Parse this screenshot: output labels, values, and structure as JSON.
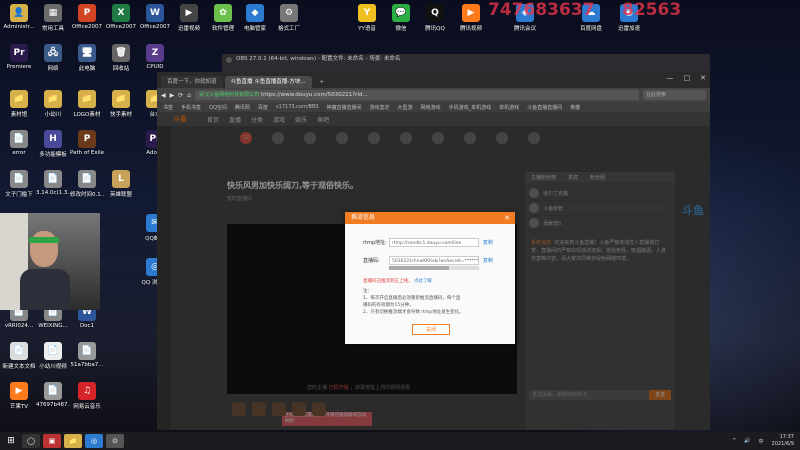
{
  "desktop": {
    "icons": [
      {
        "label": "Administr...",
        "glyph": "👤",
        "color": "#d6b04a"
      },
      {
        "label": "常用工具",
        "glyph": "▦",
        "color": "#6b6b6b"
      },
      {
        "label": "Office2007\n文档PPT",
        "glyph": "P",
        "color": "#d14424"
      },
      {
        "label": "Office2007\n表格",
        "glyph": "X",
        "color": "#1f7a44"
      },
      {
        "label": "Office2007\n文字",
        "glyph": "W",
        "color": "#2b579a"
      },
      {
        "label": "迅雷视频",
        "glyph": "▶",
        "color": "#444"
      },
      {
        "label": "软件管理",
        "glyph": "✿",
        "color": "#6ac04a"
      },
      {
        "label": "电脑管家",
        "glyph": "◆",
        "color": "#2d7bd1"
      },
      {
        "label": "格式工厂",
        "glyph": "⚙",
        "color": "#777"
      },
      {
        "label": "YY语音",
        "glyph": "Y",
        "color": "#f0c020"
      },
      {
        "label": "微信",
        "glyph": "💬",
        "color": "#2aae43"
      },
      {
        "label": "腾讯QQ",
        "glyph": "Q",
        "color": "#111"
      },
      {
        "label": "腾讯视频",
        "glyph": "▶",
        "color": "#ff7a1a"
      },
      {
        "label": "腾讯会议",
        "glyph": "◈",
        "color": "#2d7bd1"
      },
      {
        "label": "百度网盘",
        "glyph": "☁",
        "color": "#2d7bd1"
      },
      {
        "label": "迅雷加速",
        "glyph": "◉",
        "color": "#2d7bd1"
      },
      {
        "label": "Premiere\nCC2019",
        "glyph": "Pr",
        "color": "#2a1b4a"
      },
      {
        "label": "网络",
        "glyph": "🖧",
        "color": "#3a5a8a"
      },
      {
        "label": "此电脑",
        "glyph": "🖥",
        "color": "#3a5a8a"
      },
      {
        "label": "回收站",
        "glyph": "🗑",
        "color": "#666"
      },
      {
        "label": "CPUID\nCPU-Z",
        "glyph": "Z",
        "color": "#5a3a8a"
      },
      {
        "label": "素材馆",
        "glyph": "📁",
        "color": "#d6b04a"
      },
      {
        "label": "小幼川\n3u",
        "glyph": "📁",
        "color": "#d6b04a"
      },
      {
        "label": "LOGO素材",
        "glyph": "📁",
        "color": "#d6b04a"
      },
      {
        "label": "快手素材",
        "glyph": "📁",
        "color": "#d6b04a"
      },
      {
        "label": "台本",
        "glyph": "📁",
        "color": "#d6b04a"
      },
      {
        "label": "error",
        "glyph": "📄",
        "color": "#888"
      },
      {
        "label": "多功能模板\nAHK",
        "glyph": "H",
        "color": "#4a4a9a"
      },
      {
        "label": "Path of Exile",
        "glyph": "P",
        "color": "#6a3a1a"
      },
      {
        "label": "Adobe\nPremiere...",
        "glyph": "Pr",
        "color": "#2a1b4a"
      },
      {
        "label": "文子门槛下\n地址",
        "glyph": "📄",
        "color": "#888"
      },
      {
        "label": "3.14.0c(1.3...",
        "glyph": "📄",
        "color": "#888"
      },
      {
        "label": "修改时间0.1...",
        "glyph": "📄",
        "color": "#888"
      },
      {
        "label": "英雄联盟",
        "glyph": "L",
        "color": "#c8a25a"
      },
      {
        "label": "QQ邮箱",
        "glyph": "✉",
        "color": "#2d7bd1"
      },
      {
        "label": "QQ 浏览器",
        "glyph": "◎",
        "color": "#2d7bd1"
      },
      {
        "label": "vRRI024...",
        "glyph": "📄",
        "color": "#888"
      },
      {
        "label": "WEIXING...",
        "glyph": "📄",
        "color": "#888"
      },
      {
        "label": "Doc1",
        "glyph": "W",
        "color": "#2b579a"
      },
      {
        "label": "新建文本文档\n(2)",
        "glyph": "📄",
        "color": "#ddd"
      },
      {
        "label": "小幼川视频\n合辑面...",
        "glyph": "📄",
        "color": "#eee"
      },
      {
        "label": "51a7bba7...",
        "glyph": "📄",
        "color": "#999"
      },
      {
        "label": "芒果TV",
        "glyph": "▶",
        "color": "#ff7a1a"
      },
      {
        "label": "47697b487...",
        "glyph": "📄",
        "color": "#999"
      },
      {
        "label": "网易云音乐",
        "glyph": "♫",
        "color": "#d6252a"
      }
    ],
    "overlay_numbers": {
      "left": "747683637",
      "right": "82563"
    }
  },
  "obs": {
    "title": "OBS 27.0.1 (64-bit, windows) - 配置文件: 未命名 - 场景: 未命名"
  },
  "browser": {
    "tabs": [
      "百度一下，你就知道",
      "斗鱼直播 斗鱼直播直播-方块..."
    ],
    "new_tab": "+",
    "url": "https://www.douyu.com/5030221?rid...",
    "secure_label": "武汉斗鱼网络科技有限公司",
    "search_placeholder": "在此搜索",
    "bookmarks": [
      "书签",
      "手机书签",
      "QQ空间",
      "腾讯网",
      "百度",
      "c17173.com/BBS",
      "神魔直播直播间",
      "游戏鉴定",
      "大型游",
      "网络游戏",
      "手机游戏_单机游戏",
      "单机游戏",
      "斗鱼直播直播间",
      "英雄"
    ],
    "window_controls": [
      "—",
      "□",
      "✕"
    ]
  },
  "douyu": {
    "logo": "斗鱼",
    "nav": [
      "首页",
      "直播",
      "分类",
      "游戏",
      "娱乐",
      "鱼吧"
    ],
    "categories": [
      {
        "label": "12",
        "hot": true
      },
      {
        "label": "",
        "hot": false
      },
      {
        "label": "",
        "hot": false
      },
      {
        "label": "",
        "hot": false
      },
      {
        "label": "",
        "hot": false
      },
      {
        "label": "",
        "hot": false
      },
      {
        "label": "",
        "hot": false
      },
      {
        "label": "",
        "hot": false
      },
      {
        "label": "",
        "hot": false
      },
      {
        "label": "",
        "hot": false
      }
    ],
    "stream_title": "快乐风男加快乐阔刀,等于观俗快乐。",
    "stream_sub": "暂时直播间",
    "player_hint_a": "您的主播",
    "player_hint_b": "已经开播",
    "player_hint_c": "，获取地址上将的视频观看",
    "right_tabs": [
      "主播粉丝榜",
      "贵宾",
      "粉丝团"
    ],
    "right_list": [
      "道尔兰克魔",
      "斗鱼房管",
      "贡献值3"
    ],
    "chat_label": "系统消息:",
    "chat_body": "欢迎来到斗鱼直播！斗鱼严禁未成年人直播或打赏，直播间内严禁出现违法违规、低俗色情、吸烟酗酒、人身伤害等内容，请大家共同维护绿色网络环境。",
    "chat_placeholder": "发送弹幕，聊聊你的想法",
    "chat_send": "发送",
    "mascot": "斗鱼",
    "promo": "主播正在配置推流，开播后播放器将自动刷新"
  },
  "modal": {
    "title": "推流信息",
    "rtmp_label": "rtmp地址:",
    "rtmp_value": "rtmp://sendtc1.douyu.com/live",
    "code_label": "直播码:",
    "code_value": "5030221rhnwKKhx&?wsSecret=*******",
    "copy": "复制",
    "warning": "直播码已推流到正上线，",
    "warning_link": "点此了解",
    "notes": [
      "注：",
      "1、每次开启直播后必须重新推流直播码，每个直",
      "播码的有效期为15分钟。",
      "2、只有切换推流端才会导致 rtmp地址发生变化。"
    ],
    "ok": "关闭"
  },
  "taskbar": {
    "start": "⊞",
    "apps": [
      {
        "glyph": "◯",
        "color": "#333"
      },
      {
        "glyph": "▣",
        "color": "#b33"
      },
      {
        "glyph": "📁",
        "color": "#d6b04a"
      },
      {
        "glyph": "◎",
        "color": "#2d7bd1"
      },
      {
        "glyph": "⊙",
        "color": "#555"
      }
    ],
    "tray": [
      "^",
      "🔊",
      "中"
    ],
    "time": "17:37",
    "date": "2021/6/9"
  }
}
